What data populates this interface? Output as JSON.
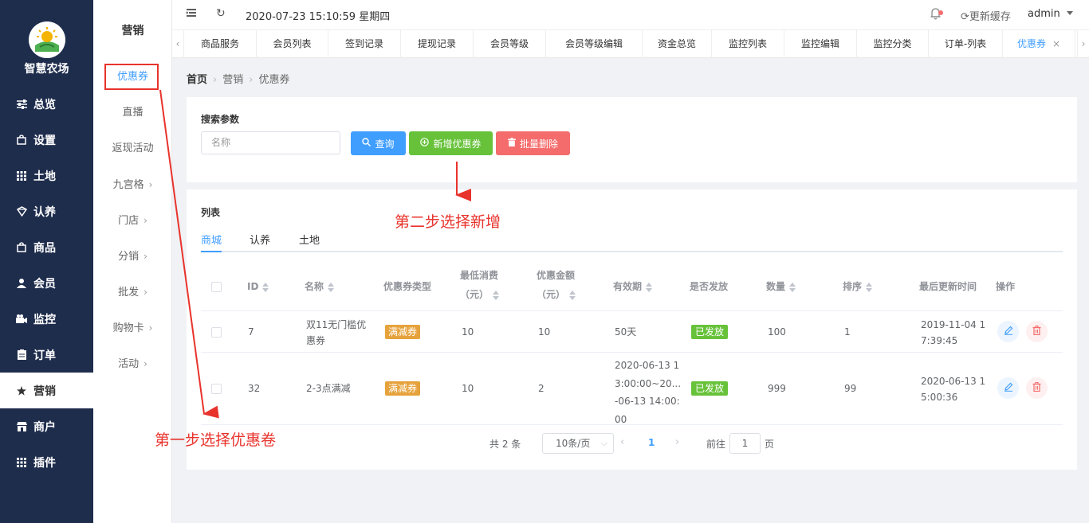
{
  "brand": {
    "name": "智慧农场"
  },
  "nav": [
    {
      "label": "总览",
      "icon": "sliders-icon"
    },
    {
      "label": "设置",
      "icon": "bag-icon"
    },
    {
      "label": "土地",
      "icon": "grid-icon"
    },
    {
      "label": "认养",
      "icon": "shield-icon"
    },
    {
      "label": "商品",
      "icon": "bag-icon"
    },
    {
      "label": "会员",
      "icon": "user-icon"
    },
    {
      "label": "监控",
      "icon": "camera-icon"
    },
    {
      "label": "订单",
      "icon": "clipboard-icon"
    },
    {
      "label": "营销",
      "icon": "star-icon"
    },
    {
      "label": "商户",
      "icon": "store-icon"
    },
    {
      "label": "插件",
      "icon": "grid-icon"
    }
  ],
  "subnav": {
    "title": "营销",
    "items": [
      "优惠券",
      "直播",
      "返现活动",
      "九宫格",
      "门店",
      "分销",
      "批发",
      "购物卡",
      "活动"
    ]
  },
  "header": {
    "datetime": "2020-07-23 15:10:59 星期四",
    "refresh_cache": "更新缓存",
    "user": "admin"
  },
  "tabs": [
    "商品服务",
    "会员列表",
    "签到记录",
    "提现记录",
    "会员等级",
    "会员等级编辑",
    "资金总览",
    "监控列表",
    "监控编辑",
    "监控分类",
    "订单-列表",
    "优惠券"
  ],
  "breadcrumb": [
    "首页",
    "营销",
    "优惠券"
  ],
  "search": {
    "label": "搜索参数",
    "placeholder": "名称",
    "query_btn": "查询",
    "add_btn": "新增优惠券",
    "batch_delete_btn": "批量删除"
  },
  "list": {
    "label": "列表",
    "tabs": [
      "商城",
      "认养",
      "土地"
    ],
    "columns": {
      "id": "ID",
      "name": "名称",
      "type": "优惠券类型",
      "min_spend": "最低消费",
      "min_spend_unit": "（元）",
      "amount": "优惠金额",
      "amount_unit": "（元）",
      "validity": "有效期",
      "issued": "是否发放",
      "qty": "数量",
      "sort": "排序",
      "updated": "最后更新时间",
      "ops": "操作"
    },
    "rows": [
      {
        "id": "7",
        "name_l1": "双11无门槛优",
        "name_l2": "惠券",
        "type": "满减券",
        "min_spend": "10",
        "amount": "10",
        "validity_l1": "50天",
        "issued": "已发放",
        "qty": "100",
        "sort": "1",
        "updated_l1": "2019-11-04 1",
        "updated_l2": "7:39:45"
      },
      {
        "id": "32",
        "name_l1": "2-3点满减",
        "type": "满减券",
        "min_spend": "10",
        "amount": "2",
        "validity_l1": "2020-06-13 1",
        "validity_l2": "3:00:00~20...",
        "validity_l3": "-06-13 14:00:",
        "validity_l4": "00",
        "issued": "已发放",
        "qty": "999",
        "sort": "99",
        "updated_l1": "2020-06-13 1",
        "updated_l2": "5:00:36"
      }
    ]
  },
  "pagination": {
    "total": "共 2 条",
    "page_size": "10条/页",
    "current": "1",
    "goto": "前往",
    "goto_value": "1",
    "page_unit": "页"
  },
  "annotations": {
    "step1": "第一步选择优惠卷",
    "step2": "第二步选择新增"
  },
  "colors": {
    "sidebar": "#1f2d4d",
    "primary": "#409eff",
    "success": "#67c23a",
    "danger": "#f56c6c",
    "warning": "#e6a23c",
    "annotation": "#e8332c"
  }
}
